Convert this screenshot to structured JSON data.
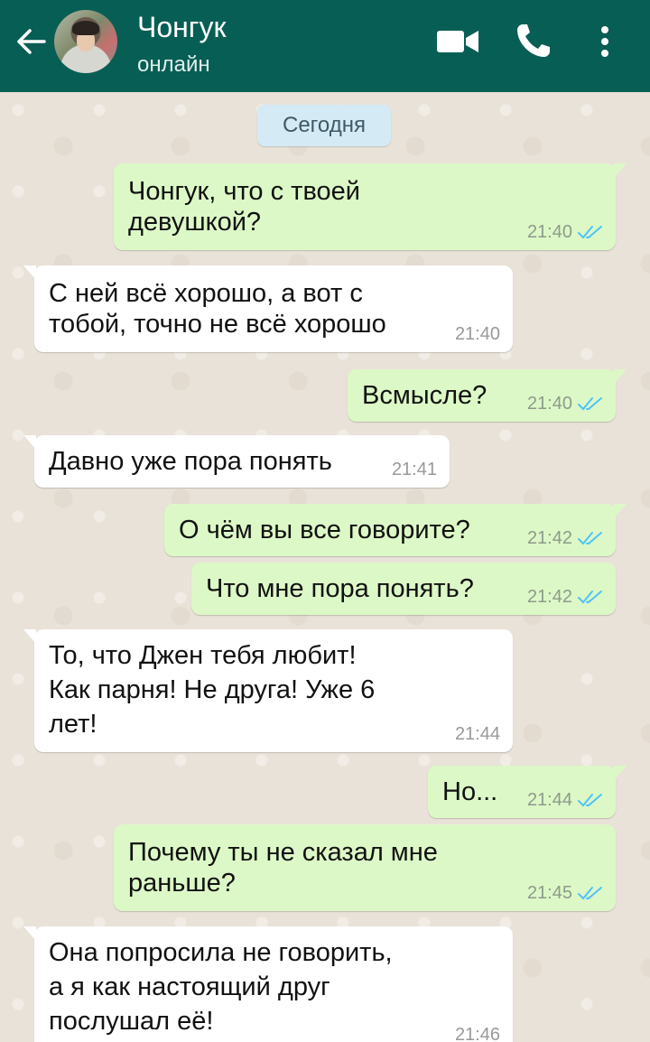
{
  "header": {
    "contact_name": "Чонгук",
    "status": "онлайн",
    "back_icon": "arrow-left-icon",
    "video_icon": "video-camera-icon",
    "call_icon": "phone-icon",
    "more_icon": "more-vertical-icon"
  },
  "date_chip": "Сегодня",
  "colors": {
    "header": "#075e54",
    "outgoing_bubble": "#dcf8c6",
    "incoming_bubble": "#ffffff",
    "read_ticks": "#4fc3f7"
  },
  "messages": [
    {
      "direction": "out",
      "lines": [
        "Чонгук, что с твоей",
        "девушкой?"
      ],
      "time": "21:40",
      "read": true
    },
    {
      "direction": "in",
      "lines": [
        "С ней всё хорошо, а вот с",
        "тобой, точно не всё хорошо"
      ],
      "time": "21:40"
    },
    {
      "direction": "out",
      "lines": [
        "Всмысле?"
      ],
      "time": "21:40",
      "read": true
    },
    {
      "direction": "in",
      "lines": [
        "Давно уже пора понять"
      ],
      "time": "21:41"
    },
    {
      "direction": "out",
      "lines": [
        "О чём вы все говорите?"
      ],
      "time": "21:42",
      "read": true
    },
    {
      "direction": "out",
      "lines": [
        "Что мне пора понять?"
      ],
      "time": "21:42",
      "read": true
    },
    {
      "direction": "in",
      "lines": [
        "То, что Джен тебя любит!",
        "Как парня! Не друга! Уже 6",
        "лет!"
      ],
      "time": "21:44"
    },
    {
      "direction": "out",
      "lines": [
        "Но..."
      ],
      "time": "21:44",
      "read": true
    },
    {
      "direction": "out",
      "lines": [
        "Почему ты не сказал мне",
        "раньше?"
      ],
      "time": "21:45",
      "read": true
    },
    {
      "direction": "in",
      "lines": [
        "Она попросила не говорить,",
        "а я как настоящий друг",
        "послушал её!"
      ],
      "time": "21:46"
    }
  ]
}
